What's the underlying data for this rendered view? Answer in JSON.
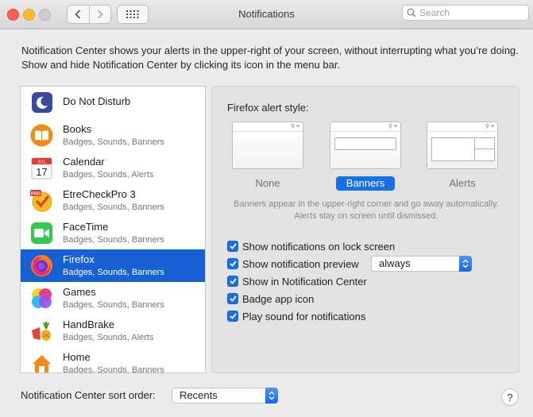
{
  "window": {
    "title": "Notifications",
    "search_placeholder": "Search"
  },
  "description": "Notification Center shows your alerts in the upper-right of your screen, without interrupting what you’re doing. Show and hide Notification Center by clicking its icon in the menu bar.",
  "apps": [
    {
      "name": "Do Not Disturb",
      "sub": "",
      "icon": "moon-icon"
    },
    {
      "name": "Books",
      "sub": "Badges, Sounds, Banners",
      "icon": "books-icon"
    },
    {
      "name": "Calendar",
      "sub": "Badges, Sounds, Alerts",
      "icon": "calendar-icon",
      "calendar_month": "JUL",
      "calendar_day": "17"
    },
    {
      "name": "EtreCheckPro 3",
      "sub": "Badges, Sounds, Banners",
      "icon": "etrecheck-icon",
      "badge": "PRO"
    },
    {
      "name": "FaceTime",
      "sub": "Badges, Sounds, Banners",
      "icon": "facetime-icon"
    },
    {
      "name": "Firefox",
      "sub": "Badges, Sounds, Banners",
      "icon": "firefox-icon"
    },
    {
      "name": "Games",
      "sub": "Badges, Sounds, Banners",
      "icon": "games-icon"
    },
    {
      "name": "HandBrake",
      "sub": "Badges, Sounds, Alerts",
      "icon": "handbrake-icon"
    },
    {
      "name": "Home",
      "sub": "Badges, Sounds, Banners",
      "icon": "home-icon"
    }
  ],
  "selected_app": "Firefox",
  "panel": {
    "alert_style_label": "Firefox alert style:",
    "styles": [
      {
        "label": "None",
        "selected": false
      },
      {
        "label": "Banners",
        "selected": true
      },
      {
        "label": "Alerts",
        "selected": false
      }
    ],
    "help_text": "Banners appear in the upper-right corner and go away automatically. Alerts stay on screen until dismissed.",
    "options": [
      {
        "label": "Show notifications on lock screen",
        "checked": true
      },
      {
        "label": "Show notification preview",
        "checked": true
      },
      {
        "label": "Show in Notification Center",
        "checked": true
      },
      {
        "label": "Badge app icon",
        "checked": true
      },
      {
        "label": "Play sound for notifications",
        "checked": true
      }
    ],
    "preview_value": "always"
  },
  "sort": {
    "label": "Notification Center sort order:",
    "value": "Recents"
  },
  "help_button_label": "?",
  "colors": {
    "accent": "#1761d4",
    "checkbox": "#1a6ee8",
    "close": "#fe5f57",
    "minimize": "#febc2e"
  }
}
